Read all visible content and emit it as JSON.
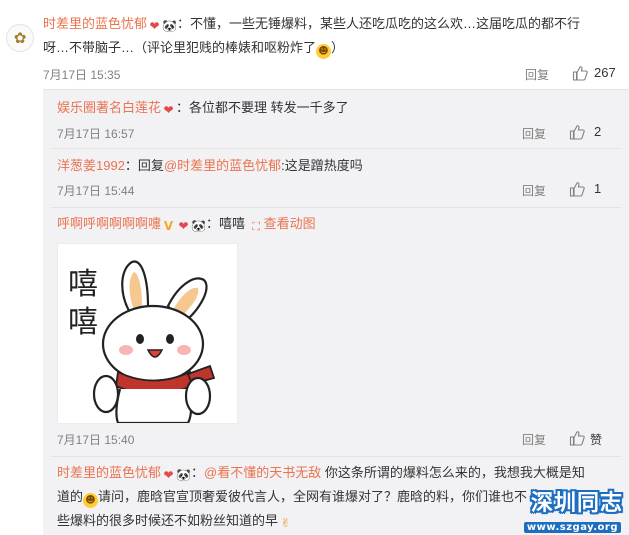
{
  "main": {
    "username": "时差里的蓝色忧郁",
    "emoji_text": "🐼",
    "text_line1": "：不懂，一些无锤爆料，某些人还吃瓜吃的这么欢…这届吃瓜的都不行",
    "text_line2": "呀…不带脑子…（评论里犯贱的棒婊和呕粉炸了",
    "text_line2_end": "）",
    "time": "7月17日 15:35",
    "reply_label": "回复",
    "like_count": "267"
  },
  "replies": [
    {
      "username": "娱乐圈著名白莲花",
      "text": "：各位都不要理 转发一千多了",
      "time": "7月17日 16:57",
      "reply_label": "回复",
      "like_count": "2"
    },
    {
      "username": "洋葱姜1992",
      "text_prefix": "：回复",
      "mention": "@时差里的蓝色忧郁",
      "text_suffix": ":这是蹭热度吗",
      "time": "7月17日 15:44",
      "reply_label": "回复",
      "like_count": "1"
    },
    {
      "username": "呼啊呼啊啊啊啊嚏",
      "text": "：嘻嘻",
      "view_gif": "查看动图",
      "sticker_caption_1": "嘻",
      "sticker_caption_2": "嘻",
      "time": "7月17日 15:40",
      "reply_label": "回复",
      "like_label": "赞"
    },
    {
      "username": "时差里的蓝色忧郁",
      "text_prefix": "：",
      "mention": "@看不懂的天书无敌",
      "text_line1": " 你这条所谓的爆料怎么来的，我想我大概是知",
      "text_line2_a": "道的",
      "text_line2_b": "请问，鹿晗官宣顶奢爱彼代言人，全网有谁爆对了？鹿晗的料，你们谁也不",
      "text_line3": "些爆料的很多时候还不如粉丝知道的早"
    }
  ],
  "watermark": {
    "title": "深圳同志",
    "url": "www.szgay.org"
  },
  "colors": {
    "username": "#eb7350",
    "meta": "#808080",
    "reply_bg": "#f2f2f5"
  }
}
